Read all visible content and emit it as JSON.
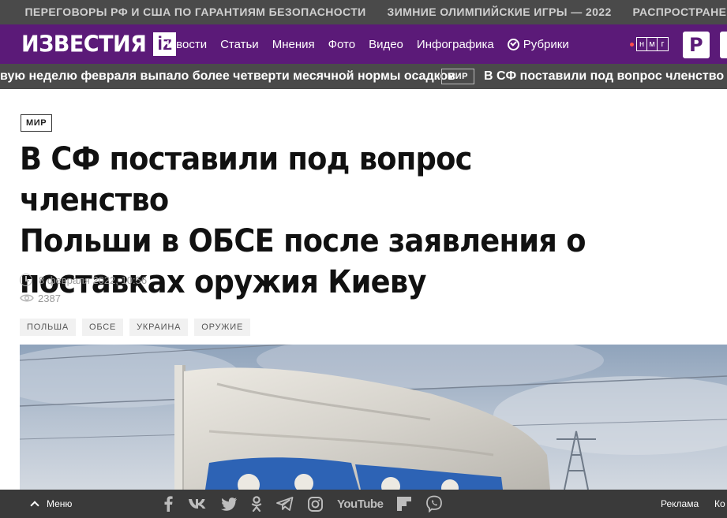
{
  "trending": [
    "ПЕРЕГОВОРЫ РФ И США ПО ГАРАНТИЯМ БЕЗОПАСНОСТИ",
    "ЗИМНИЕ ОЛИМПИЙСКИЕ ИГРЫ — 2022",
    "РАСПРОСТРАНЕНИЕ КОРОНА"
  ],
  "header": {
    "logo_text": "ИЗВЕСТИЯ",
    "logo_badge": "iz",
    "nav": [
      "Новости",
      "Статьи",
      "Мнения",
      "Фото",
      "Видео",
      "Инфографика",
      "Рубрики"
    ],
    "partner_letters": [
      "н",
      "м",
      "г"
    ],
    "ren_logo": "Р"
  },
  "ticker": {
    "prev_headline": "вую неделю февраля выпало более четверти месячной нормы осадков",
    "badge": "МИР",
    "headline": "В СФ поставили под вопрос членство По"
  },
  "article": {
    "rubric": "МИР",
    "title_lines": [
      "В СФ поставили под вопрос членство",
      "Польши в ОБСЕ после заявления о",
      "поставках оружия Киеву"
    ],
    "date": "8 февраля 2022, 10:56",
    "views": "2387",
    "tags": [
      "ПОЛЬША",
      "ОБСЕ",
      "УКРАИНА",
      "ОРУЖИЕ"
    ]
  },
  "bottombar": {
    "menu_label": "Меню",
    "social_icons": [
      "facebook-icon",
      "vk-icon",
      "twitter-icon",
      "odnoklassniki-icon",
      "telegram-icon",
      "instagram-icon",
      "youtube-icon",
      "flipboard-icon",
      "viber-icon"
    ],
    "youtube_text": "YouTube",
    "ad_label": "Реклама",
    "ad_label2": "Ко"
  }
}
